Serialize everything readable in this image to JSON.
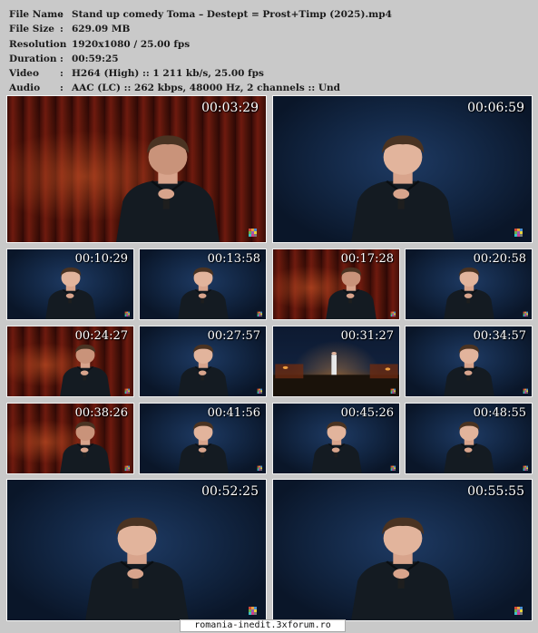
{
  "info": {
    "sep": ":",
    "rows": [
      {
        "key": "File Name",
        "value": "Stand up comedy Toma – Destept = Prost+Timp (2025).mp4"
      },
      {
        "key": "File Size",
        "value": "629.09 MB"
      },
      {
        "key": "Resolution",
        "value": "1920x1080 / 25.00 fps"
      },
      {
        "key": "Duration",
        "value": "00:59:25"
      },
      {
        "key": "Video",
        "value": "H264 (High) :: 1 211 kb/s, 25.00 fps"
      },
      {
        "key": "Audio",
        "value": "AAC (LC) :: 262 kbps, 48000 Hz, 2 channels :: Und"
      }
    ]
  },
  "thumbnails": [
    {
      "timestamp": "00:03:29",
      "scene": "red-curtain"
    },
    {
      "timestamp": "00:06:59",
      "scene": "blue"
    },
    {
      "timestamp": "00:10:29",
      "scene": "blue"
    },
    {
      "timestamp": "00:13:58",
      "scene": "blue"
    },
    {
      "timestamp": "00:17:28",
      "scene": "red-curtain"
    },
    {
      "timestamp": "00:20:58",
      "scene": "blue"
    },
    {
      "timestamp": "00:24:27",
      "scene": "red-curtain"
    },
    {
      "timestamp": "00:27:57",
      "scene": "blue"
    },
    {
      "timestamp": "00:31:27",
      "scene": "wide-stage"
    },
    {
      "timestamp": "00:34:57",
      "scene": "blue"
    },
    {
      "timestamp": "00:38:26",
      "scene": "red-curtain"
    },
    {
      "timestamp": "00:41:56",
      "scene": "blue"
    },
    {
      "timestamp": "00:45:26",
      "scene": "blue"
    },
    {
      "timestamp": "00:48:55",
      "scene": "blue"
    },
    {
      "timestamp": "00:52:25",
      "scene": "blue"
    },
    {
      "timestamp": "00:55:55",
      "scene": "blue"
    }
  ],
  "footer": {
    "text": "romania-inedit.3xforum.ro"
  },
  "colors": {
    "background": "#c9c9c9",
    "text": "#1b1b1b",
    "timestamp": "#ffffff",
    "logo": [
      "#d4493a",
      "#e7a23c",
      "#4a8fd1",
      "#6cb34b",
      "#9b59b6",
      "#e7d43c",
      "#3cc1c7",
      "#d13c8a",
      "#7a7a7a"
    ]
  }
}
